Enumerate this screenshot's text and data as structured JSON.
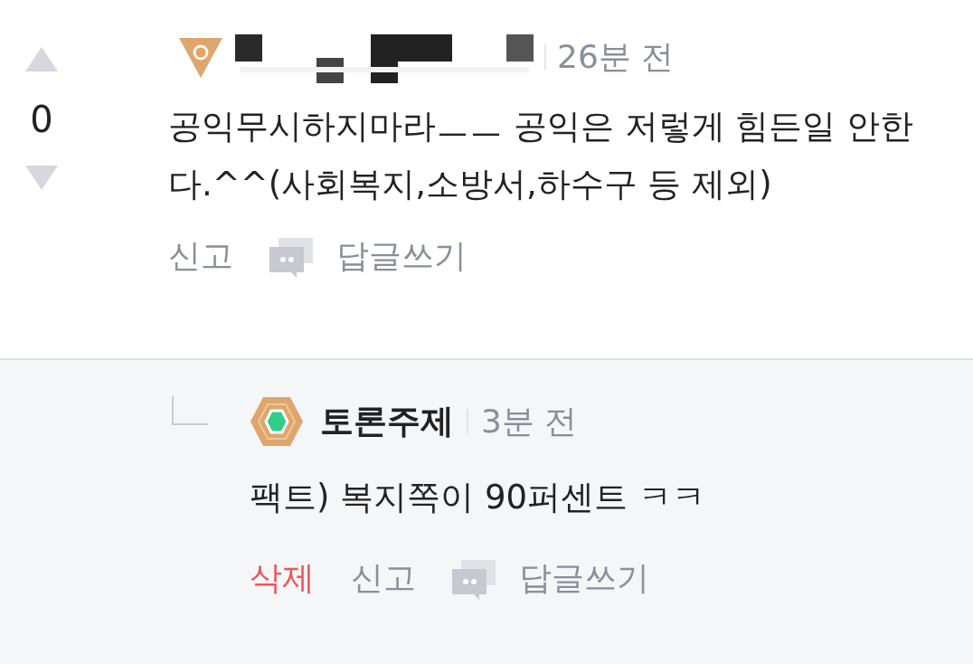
{
  "comment": {
    "votes": "0",
    "time": "26분 전",
    "text": "공익무시하지마라ㅡㅡ 공익은 저렇게 힘든일 안한다.^^(사회복지,소방서,하수구 등 제외)",
    "actions": [
      {
        "kind": "report",
        "label": "신고"
      },
      {
        "kind": "reply",
        "label": "답글쓰기"
      }
    ]
  },
  "reply": {
    "author": "토론주제",
    "time": "3분 전",
    "text": "팩트) 복지쪽이 90퍼센트 ㅋㅋ",
    "actions": [
      {
        "kind": "delete",
        "label": "삭제"
      },
      {
        "kind": "report",
        "label": "신고"
      },
      {
        "kind": "reply",
        "label": "답글쓰기"
      }
    ]
  }
}
